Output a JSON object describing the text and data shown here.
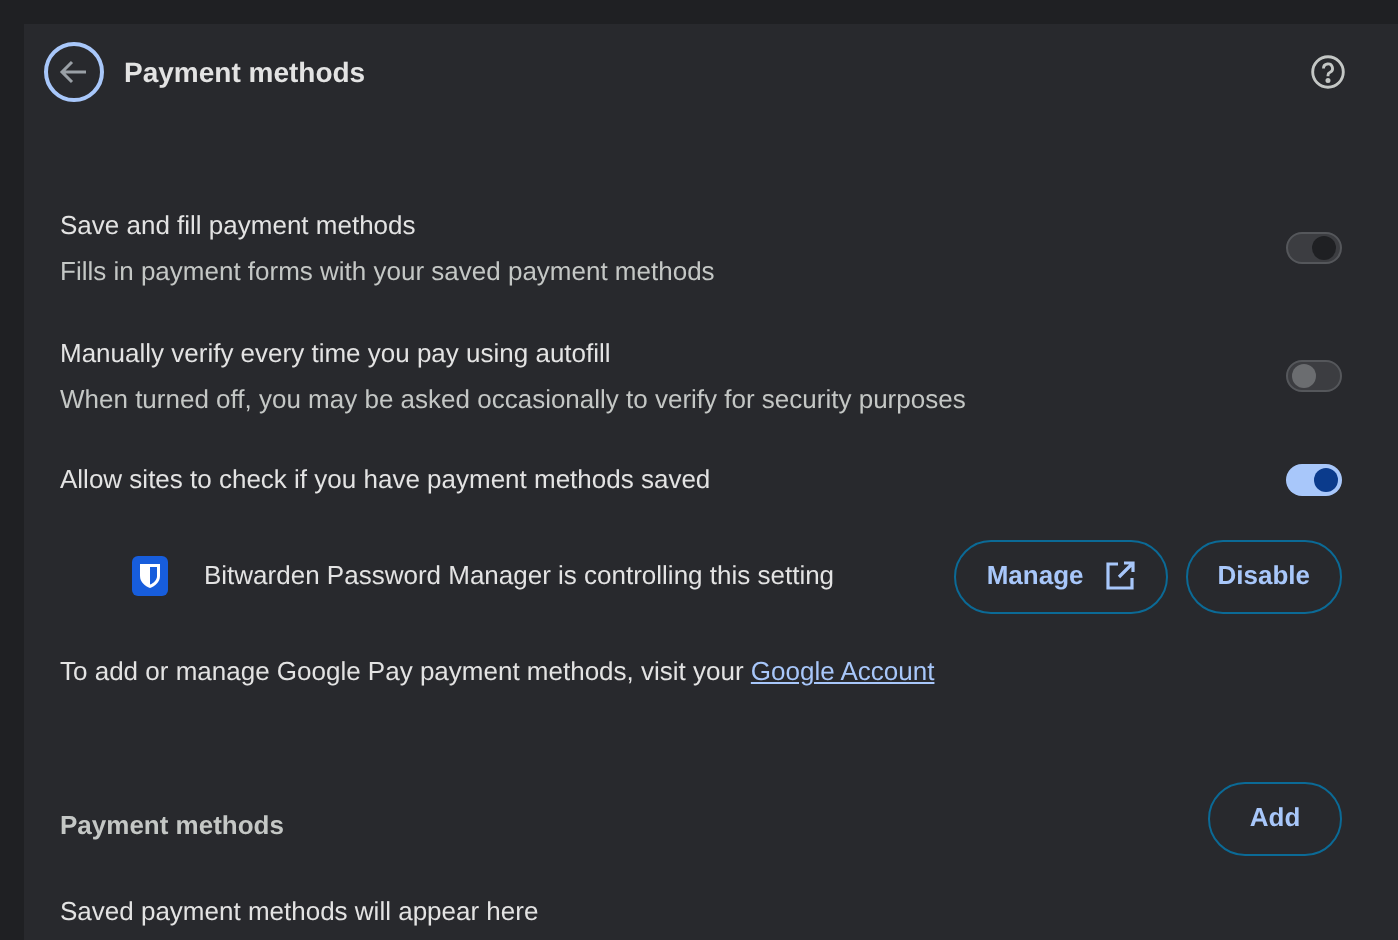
{
  "header": {
    "title": "Payment methods"
  },
  "settings": [
    {
      "label": "Save and fill payment methods",
      "description": "Fills in payment forms with your saved payment methods",
      "on": true,
      "disabled": true
    },
    {
      "label": "Manually verify every time you pay using autofill",
      "description": "When turned off, you may be asked occasionally to verify for security purposes",
      "on": false,
      "disabled": true
    },
    {
      "label": "Allow sites to check if you have payment methods saved",
      "on": true,
      "disabled": false
    }
  ],
  "extension_notice": {
    "text": "Bitwarden Password Manager is controlling this setting",
    "buttons": [
      {
        "label": "Manage",
        "kind": "external"
      },
      {
        "label": "Disable",
        "kind": "plain"
      }
    ]
  },
  "google_pay": {
    "text": "To add or manage Google Pay payment methods, visit your",
    "link": "Google Account"
  },
  "payment_methods": {
    "heading": "Payment methods",
    "add_button": "Add",
    "empty_text": "Saved payment methods will appear here"
  }
}
